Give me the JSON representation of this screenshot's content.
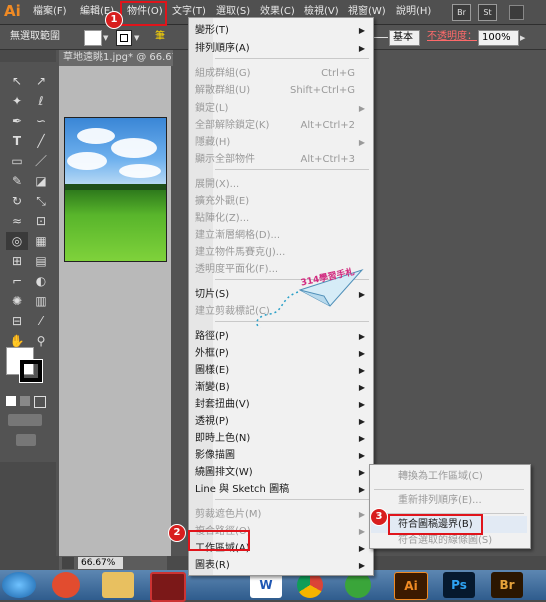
{
  "menubar": {
    "logo": "Ai",
    "items": [
      "檔案(F)",
      "編輯(E)",
      "物件(O)",
      "文字(T)",
      "選取(S)",
      "效果(C)",
      "檢視(V)",
      "視窗(W)",
      "說明(H)"
    ],
    "app_buttons": [
      "Br",
      "St"
    ]
  },
  "controlbar": {
    "selection": "無選取範圍",
    "basic": "基本",
    "opacity_label": "不透明度：",
    "opacity_value": "100%",
    "left_fragment": "筆"
  },
  "document": {
    "tab": "草地遠眺1.jpg* @ 66.67"
  },
  "status": {
    "zoom": "66.67%"
  },
  "object_menu": {
    "items": [
      {
        "label": "變形(T)",
        "shortcut": "",
        "submenu": true,
        "enabled": true
      },
      {
        "label": "排列順序(A)",
        "shortcut": "",
        "submenu": true,
        "enabled": true
      },
      {
        "label": "組成群組(G)",
        "shortcut": "Ctrl+G",
        "submenu": false,
        "enabled": false
      },
      {
        "label": "解散群組(U)",
        "shortcut": "Shift+Ctrl+G",
        "submenu": false,
        "enabled": false
      },
      {
        "label": "鎖定(L)",
        "shortcut": "",
        "submenu": true,
        "enabled": false
      },
      {
        "label": "全部解除鎖定(K)",
        "shortcut": "Alt+Ctrl+2",
        "submenu": false,
        "enabled": false
      },
      {
        "label": "隱藏(H)",
        "shortcut": "",
        "submenu": true,
        "enabled": false
      },
      {
        "label": "顯示全部物件",
        "shortcut": "Alt+Ctrl+3",
        "submenu": false,
        "enabled": false
      },
      {
        "label": "展開(X)...",
        "shortcut": "",
        "submenu": false,
        "enabled": false
      },
      {
        "label": "擴充外觀(E)",
        "shortcut": "",
        "submenu": false,
        "enabled": false
      },
      {
        "label": "點陣化(Z)...",
        "shortcut": "",
        "submenu": false,
        "enabled": false
      },
      {
        "label": "建立漸層網格(D)...",
        "shortcut": "",
        "submenu": false,
        "enabled": false
      },
      {
        "label": "建立物件馬賽克(J)...",
        "shortcut": "",
        "submenu": false,
        "enabled": false
      },
      {
        "label": "透明度平面化(F)...",
        "shortcut": "",
        "submenu": false,
        "enabled": false
      },
      {
        "label": "切片(S)",
        "shortcut": "",
        "submenu": true,
        "enabled": true
      },
      {
        "label": "建立剪裁標記(C)",
        "shortcut": "",
        "submenu": false,
        "enabled": false
      },
      {
        "label": "路徑(P)",
        "shortcut": "",
        "submenu": true,
        "enabled": true
      },
      {
        "label": "外框(P)",
        "shortcut": "",
        "submenu": true,
        "enabled": true
      },
      {
        "label": "圖樣(E)",
        "shortcut": "",
        "submenu": true,
        "enabled": true
      },
      {
        "label": "漸變(B)",
        "shortcut": "",
        "submenu": true,
        "enabled": true
      },
      {
        "label": "封套扭曲(V)",
        "shortcut": "",
        "submenu": true,
        "enabled": true
      },
      {
        "label": "透視(P)",
        "shortcut": "",
        "submenu": true,
        "enabled": true
      },
      {
        "label": "即時上色(N)",
        "shortcut": "",
        "submenu": true,
        "enabled": true
      },
      {
        "label": "影像描圖",
        "shortcut": "",
        "submenu": true,
        "enabled": true
      },
      {
        "label": "繞圖排文(W)",
        "shortcut": "",
        "submenu": true,
        "enabled": true
      },
      {
        "label": "Line 與 Sketch 圖稿",
        "shortcut": "",
        "submenu": true,
        "enabled": true
      },
      {
        "label": "剪裁遮色片(M)",
        "shortcut": "",
        "submenu": true,
        "enabled": false
      },
      {
        "label": "複合路徑(O)",
        "shortcut": "",
        "submenu": true,
        "enabled": false
      },
      {
        "label": "工作區域(A)",
        "shortcut": "",
        "submenu": true,
        "enabled": true
      },
      {
        "label": "圖表(R)",
        "shortcut": "",
        "submenu": true,
        "enabled": true
      }
    ]
  },
  "artboard_submenu": {
    "items": [
      {
        "label": "轉換為工作區域(C)",
        "enabled": false
      },
      {
        "label": "重新排列順序(E)...",
        "enabled": false
      },
      {
        "label": "符合圖稿邊界(B)",
        "enabled": true
      },
      {
        "label": "符合選取的線條圖(S)",
        "enabled": false
      }
    ]
  },
  "callouts": [
    "1",
    "2",
    "3"
  ],
  "watermark": "314學習手札",
  "colors": {
    "highlight": "#e0141b",
    "ai_orange": "#f08a24",
    "opacity_red": "#ff6a6a",
    "accent_yellow": "#ffd800"
  },
  "icons": {
    "tools": [
      "selection-icon",
      "direct-selection-icon",
      "magic-wand-icon",
      "lasso-icon",
      "pen-icon",
      "curvature-icon",
      "type-icon",
      "line-icon",
      "rectangle-icon",
      "paintbrush-icon",
      "pencil-icon",
      "eraser-icon",
      "rotate-icon",
      "scale-icon",
      "width-icon",
      "free-transform-icon",
      "shape-builder-icon",
      "perspective-icon",
      "mesh-icon",
      "gradient-icon",
      "eyedropper-icon",
      "blend-icon",
      "symbol-sprayer-icon",
      "column-graph-icon",
      "artboard-icon",
      "slice-icon",
      "hand-icon",
      "zoom-icon"
    ],
    "taskbar": [
      "windows-start-icon",
      "app-icon",
      "file-explorer-icon",
      "media-icon",
      "word-icon",
      "chrome-icon",
      "refresh-icon",
      "illustrator-icon",
      "photoshop-icon",
      "bridge-icon"
    ]
  }
}
